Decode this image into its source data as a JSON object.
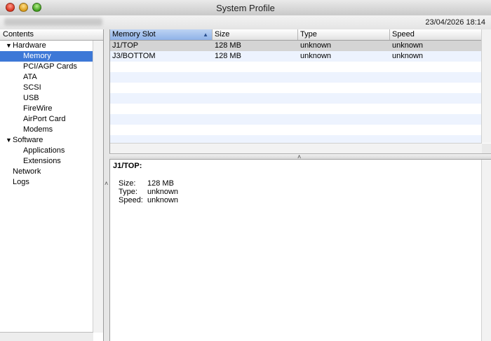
{
  "window": {
    "title": "System Profile"
  },
  "infobar": {
    "datetime": "23/04/2026 18:14"
  },
  "sidebar": {
    "header": "Contents",
    "items": [
      {
        "label": "Hardware",
        "level": 0,
        "expanded": true
      },
      {
        "label": "Memory",
        "level": 1,
        "selected": true
      },
      {
        "label": "PCI/AGP Cards",
        "level": 1
      },
      {
        "label": "ATA",
        "level": 1
      },
      {
        "label": "SCSI",
        "level": 1
      },
      {
        "label": "USB",
        "level": 1
      },
      {
        "label": "FireWire",
        "level": 1
      },
      {
        "label": "AirPort Card",
        "level": 1
      },
      {
        "label": "Modems",
        "level": 1
      },
      {
        "label": "Software",
        "level": 0,
        "expanded": true
      },
      {
        "label": "Applications",
        "level": 1
      },
      {
        "label": "Extensions",
        "level": 1
      },
      {
        "label": "Network",
        "level": 0
      },
      {
        "label": "Logs",
        "level": 0
      }
    ]
  },
  "table": {
    "columns": [
      "Memory Slot",
      "Size",
      "Type",
      "Speed"
    ],
    "rows": [
      {
        "slot": "J1/TOP",
        "size": "128 MB",
        "type": "unknown",
        "speed": "unknown"
      },
      {
        "slot": "J3/BOTTOM",
        "size": "128 MB",
        "type": "unknown",
        "speed": "unknown"
      }
    ]
  },
  "detail": {
    "title": "J1/TOP:",
    "fields": [
      {
        "key": "Size:",
        "value": "128 MB"
      },
      {
        "key": "Type:",
        "value": "unknown"
      },
      {
        "key": "Speed:",
        "value": "unknown"
      }
    ]
  },
  "colors": {
    "selection": "#3d78d7",
    "stripe": "#edf3fe",
    "sorted_header": "#9fbdea"
  }
}
